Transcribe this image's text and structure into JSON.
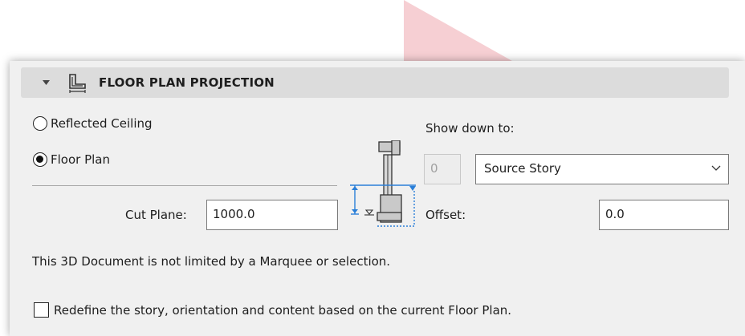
{
  "section": {
    "title": "FLOOR PLAN PROJECTION",
    "icons": {
      "collapse": "triangle-down-icon",
      "section": "floor-plan-projection-icon"
    }
  },
  "projection": {
    "options": [
      {
        "label": "Reflected Ceiling",
        "selected": false
      },
      {
        "label": "Floor Plan",
        "selected": true
      }
    ]
  },
  "cut_plane": {
    "label": "Cut Plane:",
    "value": "1000.0"
  },
  "show_down_to": {
    "label": "Show down to:",
    "number_value": "0",
    "story_value": "Source Story"
  },
  "offset": {
    "label": "Offset:",
    "value": "0.0"
  },
  "info_text": "This 3D Document is not limited by a Marquee or selection.",
  "redefine": {
    "label": "Redefine the story, orientation and content based on the current Floor Plan.",
    "checked": false
  },
  "colors": {
    "panel_bg": "#f0f0f0",
    "header_bg": "#dcdcdc",
    "accent_blue": "#2a7fd8",
    "background_triangle": "#f4c8cc"
  }
}
